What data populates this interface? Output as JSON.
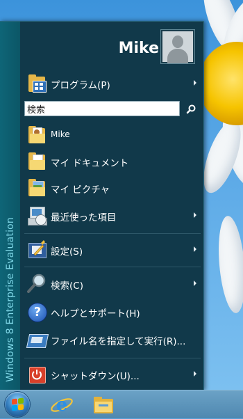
{
  "user": {
    "name": "Mike"
  },
  "edition_label": "Windows 8 Enterprise Evaluation",
  "menu": {
    "programs": "プログラム(P)",
    "search_placeholder": "検索",
    "search_value": "検索",
    "items": [
      {
        "label": "Mike"
      },
      {
        "label": "マイ ドキュメント"
      },
      {
        "label": "マイ ピクチャ"
      },
      {
        "label": "最近使った項目"
      },
      {
        "label": "設定(S)"
      },
      {
        "label": "検索(C)"
      },
      {
        "label": "ヘルプとサポート(H)"
      },
      {
        "label": "ファイル名を指定して実行(R)..."
      },
      {
        "label": "シャットダウン(U)..."
      }
    ]
  },
  "colors": {
    "menu_bg": "#11394a",
    "side_strip": "#0c5666",
    "side_text": "#7fd8e8",
    "taskbar": "#5b93bb"
  },
  "taskbar": {
    "icons": [
      "start-orb-icon",
      "internet-explorer-icon",
      "file-explorer-icon"
    ]
  }
}
